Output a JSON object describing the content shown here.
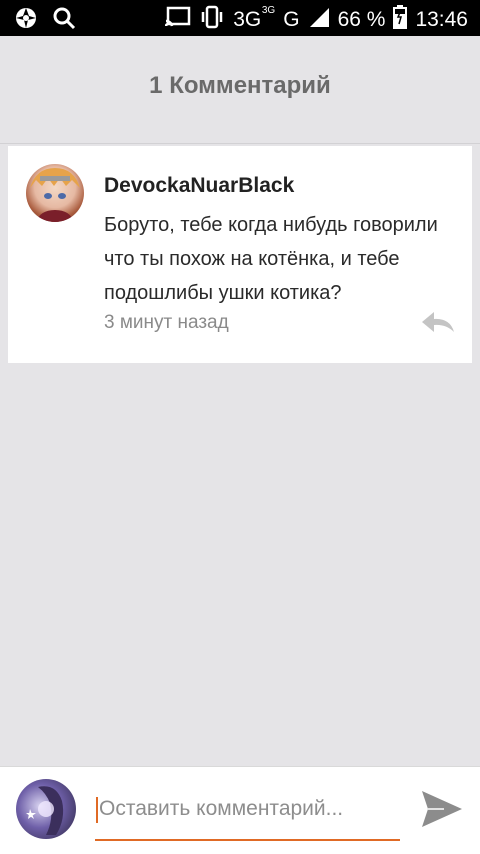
{
  "status_bar": {
    "icons_left": [
      "aperture-icon",
      "search-icon"
    ],
    "icons_right": [
      "cast-icon",
      "vibrate-icon",
      "signal-icon",
      "battery-icon"
    ],
    "network_3g": "3G",
    "network_3g_sup": "3G",
    "network_g": "G",
    "battery": "66 %",
    "time": "13:46"
  },
  "header": {
    "title": "1 Комментарий"
  },
  "comment": {
    "author": "DevockaNuarBlack",
    "text": "Боруто, тебе когда нибудь говорили что ты похож на котёнка, и тебе подошлибы ушки котика?",
    "time": "3 минут назад"
  },
  "composer": {
    "placeholder": "Оставить комментарий..."
  },
  "colors": {
    "accent": "#e06a25",
    "background": "#e5e4e7"
  }
}
